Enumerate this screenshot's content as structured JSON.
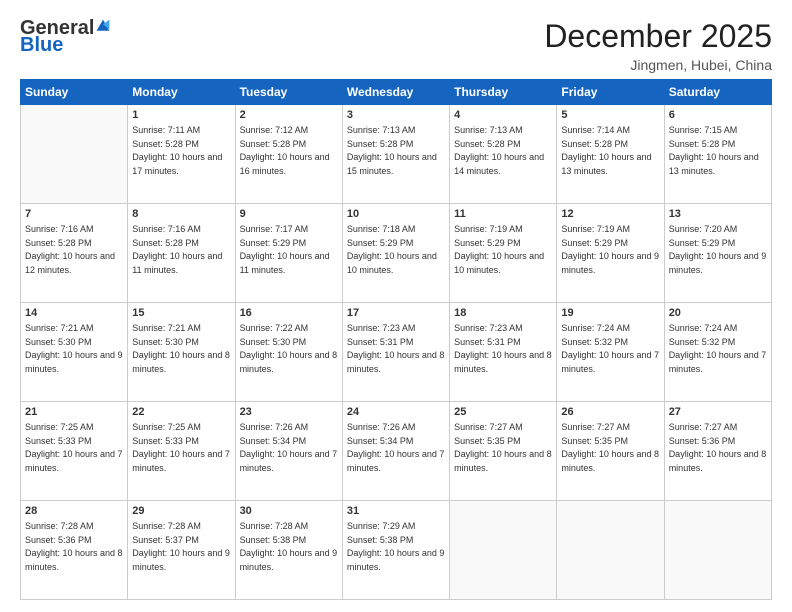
{
  "logo": {
    "general": "General",
    "blue": "Blue"
  },
  "title": "December 2025",
  "location": "Jingmen, Hubei, China",
  "days_of_week": [
    "Sunday",
    "Monday",
    "Tuesday",
    "Wednesday",
    "Thursday",
    "Friday",
    "Saturday"
  ],
  "weeks": [
    [
      {
        "day": "",
        "empty": true
      },
      {
        "day": "1",
        "sunrise": "7:11 AM",
        "sunset": "5:28 PM",
        "daylight": "10 hours and 17 minutes."
      },
      {
        "day": "2",
        "sunrise": "7:12 AM",
        "sunset": "5:28 PM",
        "daylight": "10 hours and 16 minutes."
      },
      {
        "day": "3",
        "sunrise": "7:13 AM",
        "sunset": "5:28 PM",
        "daylight": "10 hours and 15 minutes."
      },
      {
        "day": "4",
        "sunrise": "7:13 AM",
        "sunset": "5:28 PM",
        "daylight": "10 hours and 14 minutes."
      },
      {
        "day": "5",
        "sunrise": "7:14 AM",
        "sunset": "5:28 PM",
        "daylight": "10 hours and 13 minutes."
      },
      {
        "day": "6",
        "sunrise": "7:15 AM",
        "sunset": "5:28 PM",
        "daylight": "10 hours and 13 minutes."
      }
    ],
    [
      {
        "day": "7",
        "sunrise": "7:16 AM",
        "sunset": "5:28 PM",
        "daylight": "10 hours and 12 minutes."
      },
      {
        "day": "8",
        "sunrise": "7:16 AM",
        "sunset": "5:28 PM",
        "daylight": "10 hours and 11 minutes."
      },
      {
        "day": "9",
        "sunrise": "7:17 AM",
        "sunset": "5:29 PM",
        "daylight": "10 hours and 11 minutes."
      },
      {
        "day": "10",
        "sunrise": "7:18 AM",
        "sunset": "5:29 PM",
        "daylight": "10 hours and 10 minutes."
      },
      {
        "day": "11",
        "sunrise": "7:19 AM",
        "sunset": "5:29 PM",
        "daylight": "10 hours and 10 minutes."
      },
      {
        "day": "12",
        "sunrise": "7:19 AM",
        "sunset": "5:29 PM",
        "daylight": "10 hours and 9 minutes."
      },
      {
        "day": "13",
        "sunrise": "7:20 AM",
        "sunset": "5:29 PM",
        "daylight": "10 hours and 9 minutes."
      }
    ],
    [
      {
        "day": "14",
        "sunrise": "7:21 AM",
        "sunset": "5:30 PM",
        "daylight": "10 hours and 9 minutes."
      },
      {
        "day": "15",
        "sunrise": "7:21 AM",
        "sunset": "5:30 PM",
        "daylight": "10 hours and 8 minutes."
      },
      {
        "day": "16",
        "sunrise": "7:22 AM",
        "sunset": "5:30 PM",
        "daylight": "10 hours and 8 minutes."
      },
      {
        "day": "17",
        "sunrise": "7:23 AM",
        "sunset": "5:31 PM",
        "daylight": "10 hours and 8 minutes."
      },
      {
        "day": "18",
        "sunrise": "7:23 AM",
        "sunset": "5:31 PM",
        "daylight": "10 hours and 8 minutes."
      },
      {
        "day": "19",
        "sunrise": "7:24 AM",
        "sunset": "5:32 PM",
        "daylight": "10 hours and 7 minutes."
      },
      {
        "day": "20",
        "sunrise": "7:24 AM",
        "sunset": "5:32 PM",
        "daylight": "10 hours and 7 minutes."
      }
    ],
    [
      {
        "day": "21",
        "sunrise": "7:25 AM",
        "sunset": "5:33 PM",
        "daylight": "10 hours and 7 minutes."
      },
      {
        "day": "22",
        "sunrise": "7:25 AM",
        "sunset": "5:33 PM",
        "daylight": "10 hours and 7 minutes."
      },
      {
        "day": "23",
        "sunrise": "7:26 AM",
        "sunset": "5:34 PM",
        "daylight": "10 hours and 7 minutes."
      },
      {
        "day": "24",
        "sunrise": "7:26 AM",
        "sunset": "5:34 PM",
        "daylight": "10 hours and 7 minutes."
      },
      {
        "day": "25",
        "sunrise": "7:27 AM",
        "sunset": "5:35 PM",
        "daylight": "10 hours and 8 minutes."
      },
      {
        "day": "26",
        "sunrise": "7:27 AM",
        "sunset": "5:35 PM",
        "daylight": "10 hours and 8 minutes."
      },
      {
        "day": "27",
        "sunrise": "7:27 AM",
        "sunset": "5:36 PM",
        "daylight": "10 hours and 8 minutes."
      }
    ],
    [
      {
        "day": "28",
        "sunrise": "7:28 AM",
        "sunset": "5:36 PM",
        "daylight": "10 hours and 8 minutes."
      },
      {
        "day": "29",
        "sunrise": "7:28 AM",
        "sunset": "5:37 PM",
        "daylight": "10 hours and 9 minutes."
      },
      {
        "day": "30",
        "sunrise": "7:28 AM",
        "sunset": "5:38 PM",
        "daylight": "10 hours and 9 minutes."
      },
      {
        "day": "31",
        "sunrise": "7:29 AM",
        "sunset": "5:38 PM",
        "daylight": "10 hours and 9 minutes."
      },
      {
        "day": "",
        "empty": true
      },
      {
        "day": "",
        "empty": true
      },
      {
        "day": "",
        "empty": true
      }
    ]
  ],
  "labels": {
    "sunrise": "Sunrise:",
    "sunset": "Sunset:",
    "daylight": "Daylight:"
  }
}
